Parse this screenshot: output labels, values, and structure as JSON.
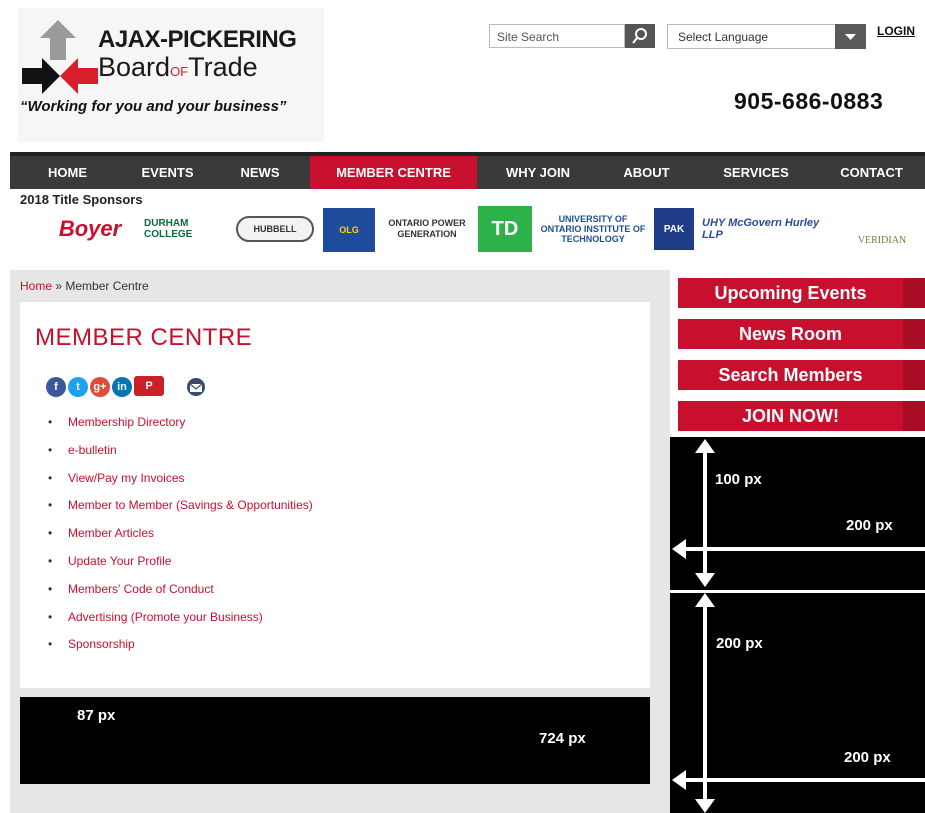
{
  "header": {
    "logo_line1_a": "AJAX-",
    "logo_line1_b": "PICKERING",
    "logo_line2_a": "Board",
    "logo_line2_b": "OF",
    "logo_line2_c": "Trade",
    "tagline": "“Working for you and your business”",
    "search_placeholder": "Site Search",
    "language_selected": "Select Language",
    "login": "LOGIN",
    "phone": "905-686-0883"
  },
  "nav": [
    "HOME",
    "EVENTS",
    "NEWS",
    "MEMBER CENTRE",
    "WHY JOIN",
    "ABOUT",
    "SERVICES",
    "CONTACT"
  ],
  "nav_active": "MEMBER CENTRE",
  "sponsors": {
    "title": "2018 Title Sponsors",
    "items": [
      "Boyer",
      "DURHAM COLLEGE",
      "HUBBELL",
      "OLG",
      "ONTARIO POWER GENERATION",
      "TD",
      "UNIVERSITY OF ONTARIO INSTITUTE OF TECHNOLOGY",
      "PAK",
      "UHY McGovern Hurley LLP",
      "VERIDIAN"
    ]
  },
  "breadcrumb": {
    "home": "Home",
    "sep": " » ",
    "current": "Member Centre"
  },
  "main": {
    "title": "MEMBER CENTRE",
    "social": [
      "f",
      "t",
      "g+",
      "in",
      "P"
    ],
    "links": [
      "Membership Directory",
      "e-bulletin",
      "View/Pay my Invoices",
      "Member to Member (Savings & Opportunities)",
      "Member Articles",
      "Update Your Profile",
      "Members' Code of Conduct",
      "Advertising (Promote your Business)",
      "Sponsorship"
    ]
  },
  "ads": {
    "bottom_height": "87 px",
    "bottom_width": "724 px",
    "right1_height": "100 px",
    "right1_width": "200 px",
    "right2_height": "200 px",
    "right2_width": "200 px"
  },
  "sidebar": {
    "buttons": [
      "Upcoming Events",
      "News Room",
      "Search Members",
      "JOIN NOW!"
    ]
  },
  "colors": {
    "brand_red": "#c8102e",
    "nav_bg": "#3a3a3a"
  }
}
